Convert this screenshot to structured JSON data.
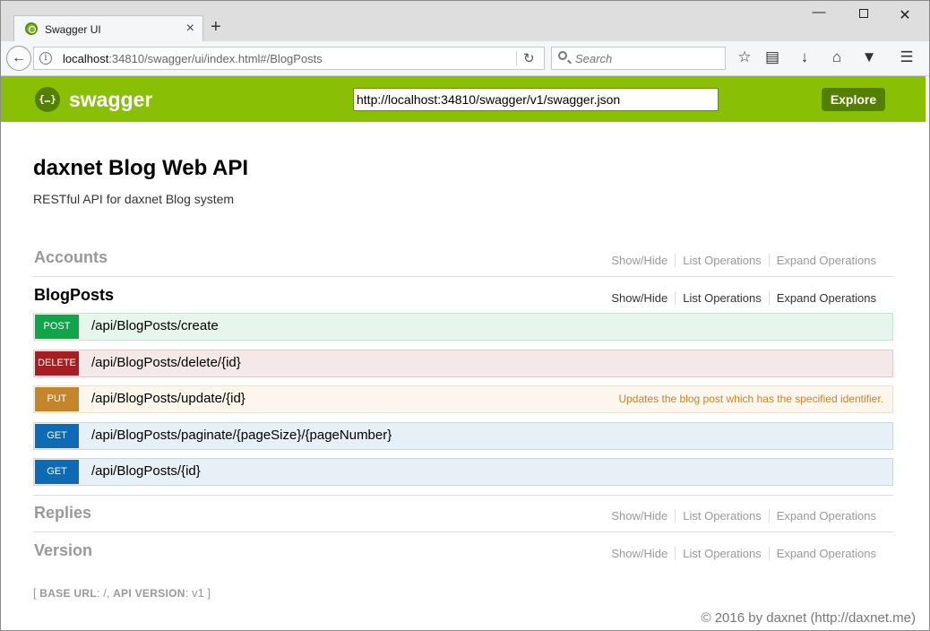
{
  "browser": {
    "tab_title": "Swagger UI",
    "tab_close": "×",
    "new_tab": "+",
    "url_host": "localhost",
    "url_rest": ":34810/swagger/ui/index.html#/BlogPosts",
    "search_placeholder": "Search",
    "win_min": "—",
    "win_close": "✕"
  },
  "header": {
    "logo_text": "swagger",
    "logo_glyph": "{…}",
    "spec_url": "http://localhost:34810/swagger/v1/swagger.json",
    "explore_label": "Explore"
  },
  "info": {
    "title": "daxnet Blog Web API",
    "description": "RESTful API for daxnet Blog system"
  },
  "resources": [
    {
      "name": "Accounts",
      "show_hide": "Show/Hide",
      "list_ops": "List Operations",
      "expand_ops": "Expand Operations"
    },
    {
      "name": "BlogPosts",
      "show_hide": "Show/Hide",
      "list_ops": "List Operations",
      "expand_ops": "Expand Operations"
    },
    {
      "name": "Replies",
      "show_hide": "Show/Hide",
      "list_ops": "List Operations",
      "expand_ops": "Expand Operations"
    },
    {
      "name": "Version",
      "show_hide": "Show/Hide",
      "list_ops": "List Operations",
      "expand_ops": "Expand Operations"
    }
  ],
  "operations": [
    {
      "method": "POST",
      "path": "/api/BlogPosts/create",
      "summary": ""
    },
    {
      "method": "DELETE",
      "path": "/api/BlogPosts/delete/{id}",
      "summary": ""
    },
    {
      "method": "PUT",
      "path": "/api/BlogPosts/update/{id}",
      "summary": "Updates the blog post which has the specified identifier."
    },
    {
      "method": "GET",
      "path": "/api/BlogPosts/paginate/{pageSize}/{pageNumber}",
      "summary": ""
    },
    {
      "method": "GET",
      "path": "/api/BlogPosts/{id}",
      "summary": ""
    }
  ],
  "footer": {
    "open_bracket": "[",
    "base_url_label": "BASE URL",
    "base_url_value": "/",
    "api_version_label": "API VERSION",
    "api_version_value": "v1",
    "close_bracket": "]"
  },
  "watermark": "© 2016 by daxnet (http://daxnet.me)",
  "colors": {
    "swagger_green": "#89bf04",
    "post": "#10a54a",
    "delete": "#a41e22",
    "put": "#c5862b",
    "get": "#0f6ab4"
  }
}
